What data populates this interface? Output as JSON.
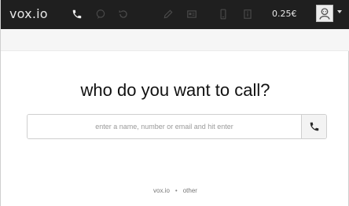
{
  "app": {
    "logo_text": "vox.io",
    "balance": "0.25€"
  },
  "toolbar": {
    "icons": [
      {
        "name": "phone-icon",
        "color": "#eeeeee",
        "enabled": true
      },
      {
        "name": "chat-icon",
        "color": "#4a4a4a",
        "enabled": false
      },
      {
        "name": "history-icon",
        "color": "#4a4a4a",
        "enabled": false
      },
      {
        "name": "edit-icon",
        "color": "#4a4a4a",
        "enabled": false
      },
      {
        "name": "contact-card-icon",
        "color": "#4a4a4a",
        "enabled": false
      },
      {
        "name": "mobile-icon",
        "color": "#4a4a4a",
        "enabled": false
      },
      {
        "name": "info-icon",
        "color": "#4a4a4a",
        "enabled": false
      }
    ]
  },
  "main": {
    "headline": "who do you want to call?",
    "search": {
      "placeholder": "enter a name, number or email and hit enter",
      "value": ""
    }
  },
  "footer": {
    "link1": "vox.io",
    "separator": "•",
    "link2": "other"
  }
}
